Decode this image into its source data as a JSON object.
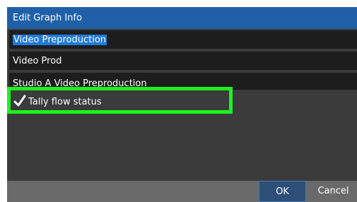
{
  "dialog": {
    "title": "Edit Graph Info"
  },
  "fields": {
    "field1_value": "Video Preproduction",
    "field2_value": "Video Prod",
    "field3_value": "Studio A Video Preproduction"
  },
  "checkbox": {
    "label": "Tally flow status",
    "checked": true
  },
  "buttons": {
    "ok": "OK",
    "cancel": "Cancel"
  },
  "colors": {
    "title_bar": "#1f60a8",
    "highlight_outline": "#1ef31e",
    "selection": "#1f7ad6"
  }
}
